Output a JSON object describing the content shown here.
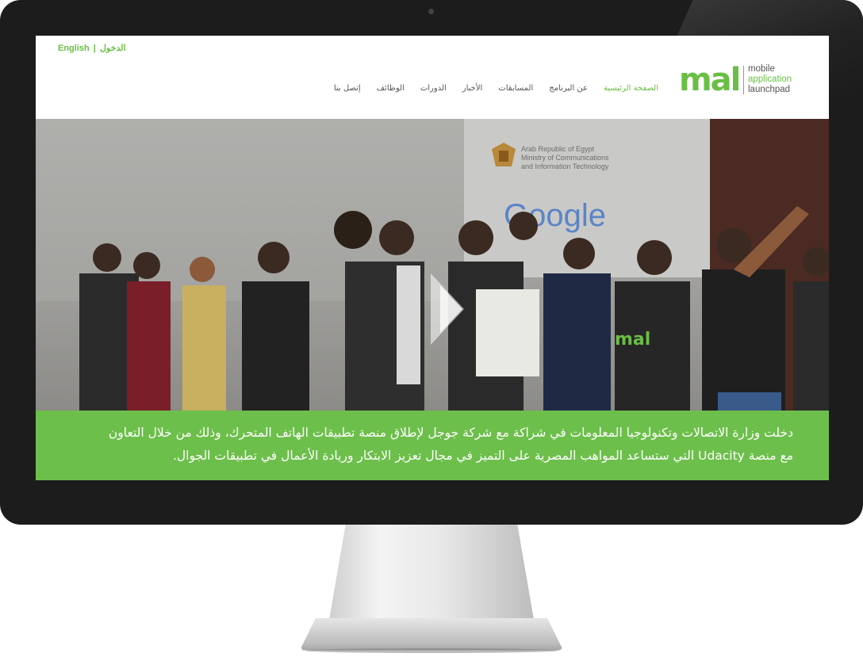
{
  "header": {
    "lang_link": "English",
    "separator": "|",
    "login_link": "الدخول",
    "logo": {
      "wordmark": "mal",
      "tag_line1": "mobile",
      "tag_line2": "application",
      "tag_line3": "launchpad"
    },
    "nav": [
      {
        "label": "الصفحة الرئيسية",
        "active": true
      },
      {
        "label": "عن البرنامج",
        "active": false
      },
      {
        "label": "المسابقات",
        "active": false
      },
      {
        "label": "الأخبار",
        "active": false
      },
      {
        "label": "الدورات",
        "active": false
      },
      {
        "label": "الوظائف",
        "active": false
      },
      {
        "label": "إتصل بنا",
        "active": false
      }
    ]
  },
  "hero": {
    "banner_line1": "Arab Republic of Egypt",
    "banner_line2": "Ministry of Communications",
    "banner_line3": "and Information Technology",
    "banner_brand": "Google",
    "shirt_text": "mal",
    "play_icon": "play-icon"
  },
  "caption": {
    "line1": "دخلت وزارة الاتصالات وتكنولوجيا المعلومات في شراكة مع شركة جوجل لإطلاق منصة تطبيقات الهاتف المتحرك، وذلك من خلال التعاون",
    "line2": "مع منصة Udacity التي ستساعد المواهب المصرية على التميز في مجال تعزيز الابتكار وريادة الأعمال في تطبيقات الجوال."
  },
  "colors": {
    "brand_green": "#6abe45",
    "caption_bg": "#6dbf4b",
    "bezel": "#1c1c1c"
  }
}
